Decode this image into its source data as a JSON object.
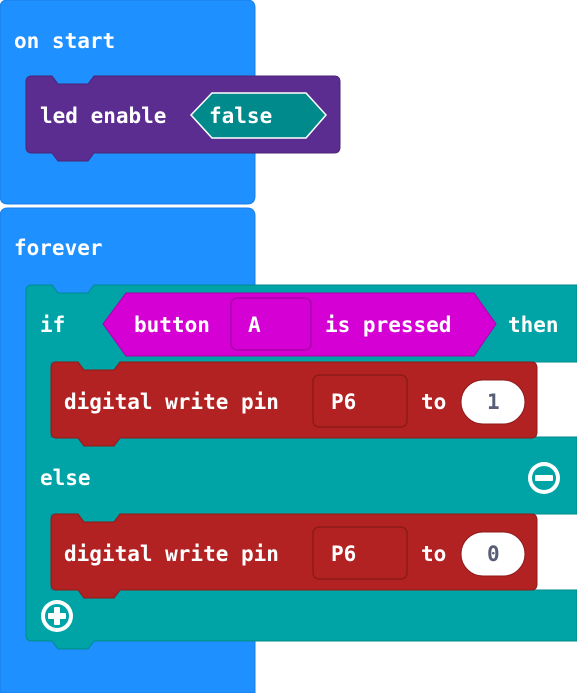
{
  "colors": {
    "basic": "#1e90ff",
    "basic_border": "#1a7ee6",
    "led": "#5c2d91",
    "led_border": "#4a2475",
    "logic": "#00a4a6",
    "logic_border": "#008a8c",
    "input": "#d400d4",
    "input_border": "#aa00aa",
    "pins": "#b22222",
    "pins_border": "#8e1b1b",
    "field_text_dark": "#575e75"
  },
  "on_start": {
    "label": "on start",
    "led_enable": {
      "label": "led enable",
      "value": "false"
    }
  },
  "forever": {
    "label": "forever",
    "if_block": {
      "if_label": "if",
      "then_label": "then",
      "else_label": "else",
      "condition": {
        "label": "button",
        "button": "A",
        "suffix": "is pressed"
      },
      "then_statement": {
        "label": "digital write pin",
        "pin": "P6",
        "to_label": "to",
        "value": "1"
      },
      "else_statement": {
        "label": "digital write pin",
        "pin": "P6",
        "to_label": "to",
        "value": "0"
      },
      "remove_else_icon": "minus-circle-icon",
      "add_icon": "plus-circle-icon"
    }
  }
}
